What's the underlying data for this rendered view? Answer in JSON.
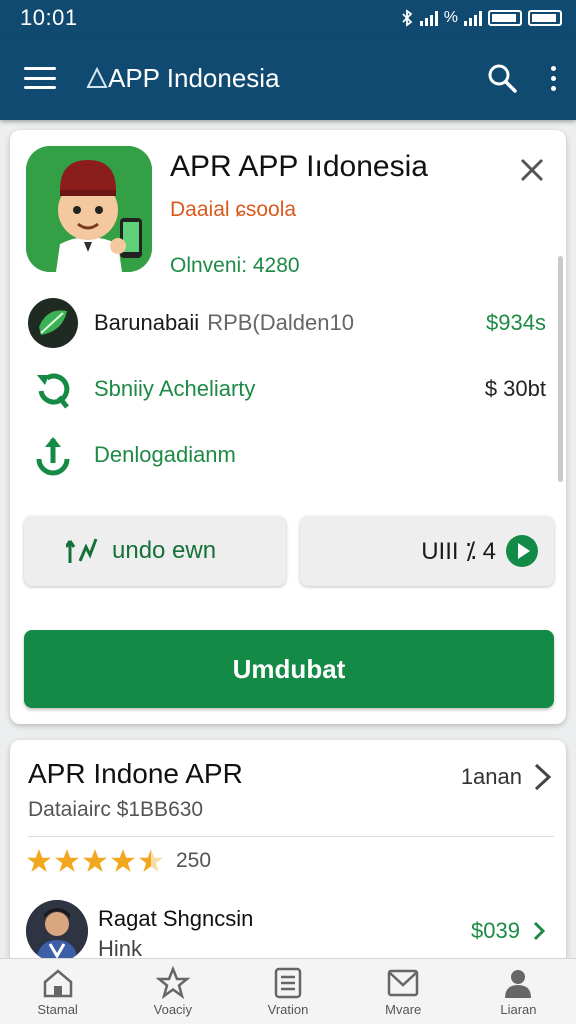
{
  "status_bar": {
    "time": "10:01",
    "signal_text": "%"
  },
  "app_bar": {
    "title": "APP Indonesia"
  },
  "app_card": {
    "name": "APR APP Iıdonesia",
    "developer": "Daaial ɕsoola",
    "version": "Olnveni: 4280",
    "rows": [
      {
        "label": "Barunabaii",
        "secondary": "RPB(Dalden10",
        "value": "$934s"
      },
      {
        "label": "Sbniiy Acheliarty",
        "value": "$ 30bt"
      },
      {
        "label": "Denlogadianm",
        "value": ""
      }
    ],
    "buttons": {
      "left_label": "undo ewn",
      "right_label": "UIII ⁒ 4",
      "primary_label": "Umdubat"
    }
  },
  "review_card": {
    "title": "APR Indone APR",
    "link_label": "1anan",
    "subtitle": "Dataiairc $1BB630",
    "rating": 4.5,
    "rating_count": "250",
    "reviewer": {
      "name": "Ragat Shgncsin",
      "sub": "Hink",
      "price": "$039"
    }
  },
  "bottom_nav": [
    {
      "label": "Stamal",
      "icon": "home-icon"
    },
    {
      "label": "Voaciy",
      "icon": "star-icon"
    },
    {
      "label": "Vration",
      "icon": "list-icon"
    },
    {
      "label": "Mvare",
      "icon": "mail-icon"
    },
    {
      "label": "Liaran",
      "icon": "profile-icon"
    }
  ],
  "colors": {
    "primary": "#104a70",
    "accent_green": "#138a45",
    "developer_orange": "#d95a1c",
    "star": "#f2a81e"
  }
}
